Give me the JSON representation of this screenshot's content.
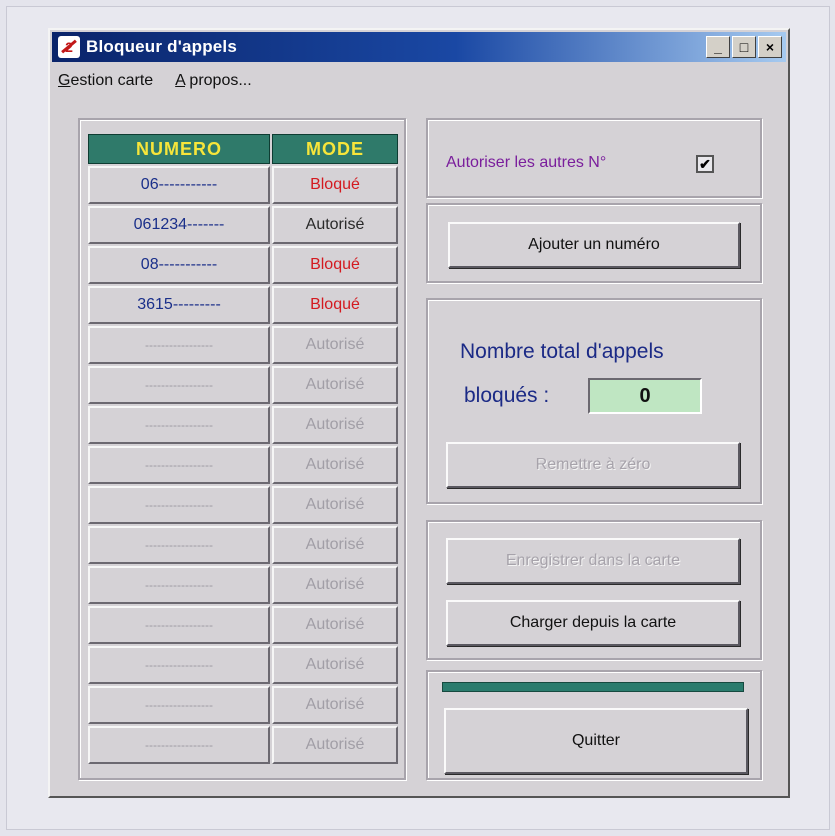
{
  "window": {
    "title": "Bloqueur d'appels",
    "controls": {
      "minimize": "_",
      "maximize": "□",
      "close": "×"
    }
  },
  "menu": {
    "items": [
      "Gestion carte",
      "A propos..."
    ]
  },
  "table": {
    "headers": {
      "number": "NUMERO",
      "mode": "MODE"
    },
    "rows": [
      {
        "number": "06-----------",
        "mode": "Bloqué",
        "status": "blocked"
      },
      {
        "number": "061234-------",
        "mode": "Autorisé",
        "status": "allowed"
      },
      {
        "number": "08-----------",
        "mode": "Bloqué",
        "status": "blocked"
      },
      {
        "number": "3615---------",
        "mode": "Bloqué",
        "status": "blocked"
      },
      {
        "number": "-----------------",
        "mode": "Autorisé",
        "status": "empty"
      },
      {
        "number": "-----------------",
        "mode": "Autorisé",
        "status": "empty"
      },
      {
        "number": "-----------------",
        "mode": "Autorisé",
        "status": "empty"
      },
      {
        "number": "-----------------",
        "mode": "Autorisé",
        "status": "empty"
      },
      {
        "number": "-----------------",
        "mode": "Autorisé",
        "status": "empty"
      },
      {
        "number": "-----------------",
        "mode": "Autorisé",
        "status": "empty"
      },
      {
        "number": "-----------------",
        "mode": "Autorisé",
        "status": "empty"
      },
      {
        "number": "-----------------",
        "mode": "Autorisé",
        "status": "empty"
      },
      {
        "number": "-----------------",
        "mode": "Autorisé",
        "status": "empty"
      },
      {
        "number": "-----------------",
        "mode": "Autorisé",
        "status": "empty"
      },
      {
        "number": "-----------------",
        "mode": "Autorisé",
        "status": "empty"
      }
    ]
  },
  "options": {
    "allow_others_label": "Autoriser les autres N°",
    "allow_others_checked": true,
    "checkmark": "✔"
  },
  "buttons": {
    "add_number": "Ajouter un numéro",
    "reset": "Remettre à zéro",
    "save_to_card": "Enregistrer dans la carte",
    "load_from_card": "Charger depuis la carte",
    "quit": "Quitter"
  },
  "stats": {
    "line1": "Nombre total d'appels",
    "line2": "bloqués :",
    "blocked_count": "0"
  },
  "colors": {
    "header_bg": "#2f7a6a",
    "header_text": "#f7e53a",
    "blocked": "#d41a20",
    "number_text": "#1a2f8a",
    "counter_bg": "#bfe6c2"
  }
}
